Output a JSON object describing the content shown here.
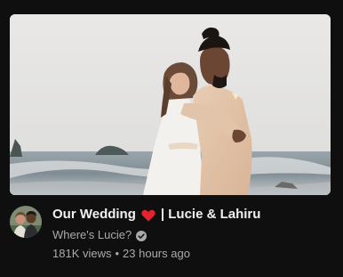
{
  "video": {
    "title_main": "Our Wedding",
    "title_emoji": "heart-emoji",
    "title_suffix": "| Lucie & Lahiru"
  },
  "channel": {
    "name": "Where's Lucie?",
    "verified_icon": "check-circle-icon"
  },
  "stats": {
    "views": "181K views",
    "separator": "•",
    "age": "23 hours ago"
  },
  "colors": {
    "background": "#0f0f0f",
    "title_text": "#f1f1f1",
    "secondary_text": "#aaaaaa",
    "heart": "#e5232e"
  }
}
